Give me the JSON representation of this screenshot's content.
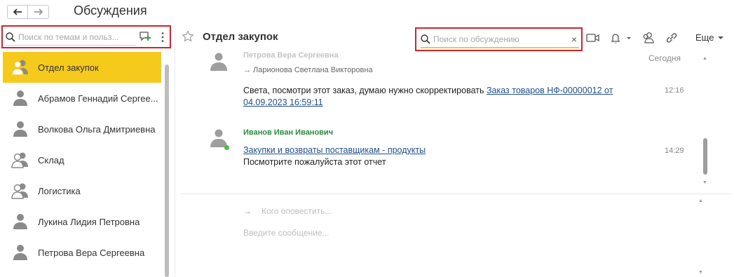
{
  "window": {
    "title": "Обсуждения"
  },
  "sidebar": {
    "search_placeholder": "Поиск по темам и польз...",
    "items": [
      {
        "label": "Отдел закупок",
        "icon": "group-icon",
        "active": true
      },
      {
        "label": "Абрамов Геннадий Сергее...",
        "icon": "user-icon"
      },
      {
        "label": "Волкова Ольга Дмитриевна",
        "icon": "user-icon"
      },
      {
        "label": "Склад",
        "icon": "group-icon"
      },
      {
        "label": "Логистика",
        "icon": "group-icon"
      },
      {
        "label": "Лукина Лидия Петровна",
        "icon": "user-icon"
      },
      {
        "label": "Петрова Вера Сергеевна",
        "icon": "user-icon"
      }
    ]
  },
  "chat": {
    "title": "Отдел закупок",
    "search_placeholder": "Поиск по обсуждению",
    "more_label": "Еще",
    "day_label": "Сегодня",
    "messages": [
      {
        "sender": "Петрова Вера Сергеевна",
        "forward_to": "→ Ларионова Светлана Викторовна",
        "text": "Света, посмотри этот заказ, думаю нужно скорректировать ",
        "link": "Заказ товаров НФ-00000012 от 04.09.2023 16:59:11",
        "time": "12:16"
      },
      {
        "sender": "Иванов Иван Иванович",
        "link": "Закупки и возвраты поставщикам - продукты",
        "text": "Посмотрите пожалуйста этот отчет",
        "time": "14:29"
      }
    ],
    "notify_placeholder": "Кого оповестить...",
    "compose_placeholder": "Введите сообщение..."
  },
  "colors": {
    "accent": "#f6c91d",
    "highlight_border": "#d0232d",
    "link": "#22508f",
    "online": "#4cba4c",
    "sender_green": "#2c8a3d"
  }
}
